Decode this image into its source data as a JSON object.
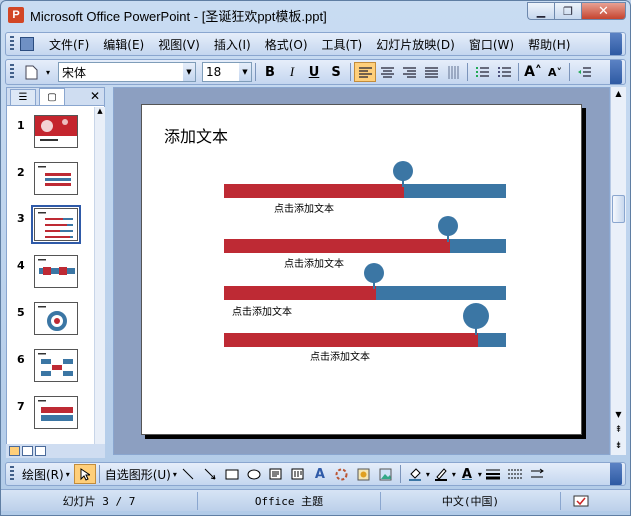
{
  "window": {
    "app_icon": "powerpoint-icon",
    "app_icon_glyph": "P",
    "title": "Microsoft Office PowerPoint - [圣诞狂欢ppt模板.ppt]",
    "minimize_glyph": "▁",
    "restore_glyph": "❐",
    "close_glyph": "✕"
  },
  "menubar": {
    "items": [
      "文件(F)",
      "编辑(E)",
      "视图(V)",
      "插入(I)",
      "格式(O)",
      "工具(T)",
      "幻灯片放映(D)",
      "窗口(W)",
      "帮助(H)"
    ]
  },
  "toolbar": {
    "font_name": "宋体",
    "font_size": "18",
    "bold": "B",
    "italic": "I",
    "underline": "U",
    "shadow": "S",
    "grow_font": "A˄",
    "shrink_font": "A˅"
  },
  "left_pane": {
    "tabs": [
      {
        "icon": "outline-icon",
        "glyph": "☰"
      },
      {
        "icon": "slides-icon",
        "glyph": "▢"
      }
    ],
    "close_glyph": "✕",
    "thumbnails": [
      {
        "number": "1",
        "selected": false
      },
      {
        "number": "2",
        "selected": false
      },
      {
        "number": "3",
        "selected": true
      },
      {
        "number": "4",
        "selected": false
      },
      {
        "number": "5",
        "selected": false
      },
      {
        "number": "6",
        "selected": false
      },
      {
        "number": "7",
        "selected": false
      }
    ]
  },
  "slide": {
    "title": "添加文本",
    "rows": [
      {
        "label": "点击添加文本",
        "red_fraction": 0.64
      },
      {
        "label": "点击添加文本",
        "red_fraction": 0.8
      },
      {
        "label": "点击添加文本",
        "red_fraction": 0.54
      },
      {
        "label": "点击添加文本",
        "red_fraction": 0.9
      }
    ]
  },
  "drawbar": {
    "draw_label": "绘图(R)",
    "autoshapes_label": "自选图形(U)"
  },
  "statusbar": {
    "slide_info": "幻灯片 3 / 7",
    "theme": "Office 主题",
    "language": "中文(中国)"
  },
  "colors": {
    "red_bar": "#be2a34",
    "blue_bar": "#3b76a4",
    "workarea": "#8c9fc1"
  }
}
